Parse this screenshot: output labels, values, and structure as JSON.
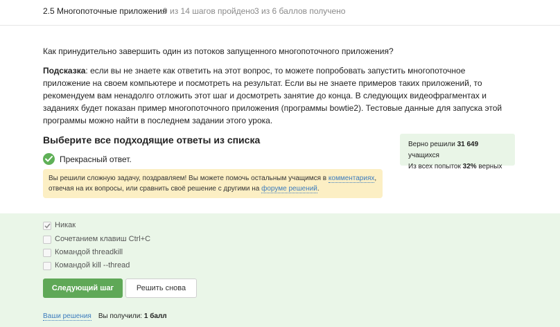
{
  "header": {
    "lesson_title": "2.5 Многопоточные приложения",
    "steps_progress": "9 из 14 шагов пройдено",
    "score": "3 из 6 баллов  получено"
  },
  "question": "Как принудительно завершить один из потоков запущенного многопоточного приложения?",
  "hint": {
    "label": "Подсказка",
    "text": ": если вы не знаете как ответить на этот вопрос, то можете попробовать запустить многопоточное приложение на своем компьютере и посмотреть на результат. Если вы не знаете примеров таких приложений, то рекомендуем вам ненадолго отложить этот шаг и досмотреть занятие до конца. В следующих видеофрагментах и заданиях будет показан пример многопоточного приложения (программы bowtie2). Тестовые данные для запуска этой программы можно найти в последнем задании этого урока."
  },
  "choose_title": "Выберите все подходящие ответы из списка",
  "result": {
    "text": "Прекрасный ответ."
  },
  "congrats": {
    "part1": "Вы решили сложную задачу, поздравляем! Вы можете помочь остальным учащимся в ",
    "comments_link": "комментариях",
    "part2": ", отвечая на их вопросы, или сравнить своё решение с другими на ",
    "forum_link": "форуме решений",
    "part3": "."
  },
  "stats": {
    "solved_prefix": "Верно решили ",
    "solved_count": "31 649",
    "solved_suffix": " учащихся",
    "attempts_prefix": "Из всех попыток ",
    "attempts_percent": "32%",
    "attempts_suffix": " верных"
  },
  "options": [
    {
      "label": "Никак",
      "checked": true
    },
    {
      "label": "Сочетанием клавиш Ctrl+C",
      "checked": false
    },
    {
      "label": "Командой threadkill",
      "checked": false
    },
    {
      "label": "Командой kill --thread",
      "checked": false
    }
  ],
  "buttons": {
    "next": "Следующий шаг",
    "retry": "Решить снова"
  },
  "footer": {
    "your_solutions": "Ваши решения",
    "received_prefix": "Вы получили: ",
    "received_value": "1 балл"
  },
  "colors": {
    "accent_green": "#5fa857",
    "answer_area": "#eaf6e8",
    "congrats_bg": "#fcefc4",
    "link": "#3b7bbd"
  }
}
